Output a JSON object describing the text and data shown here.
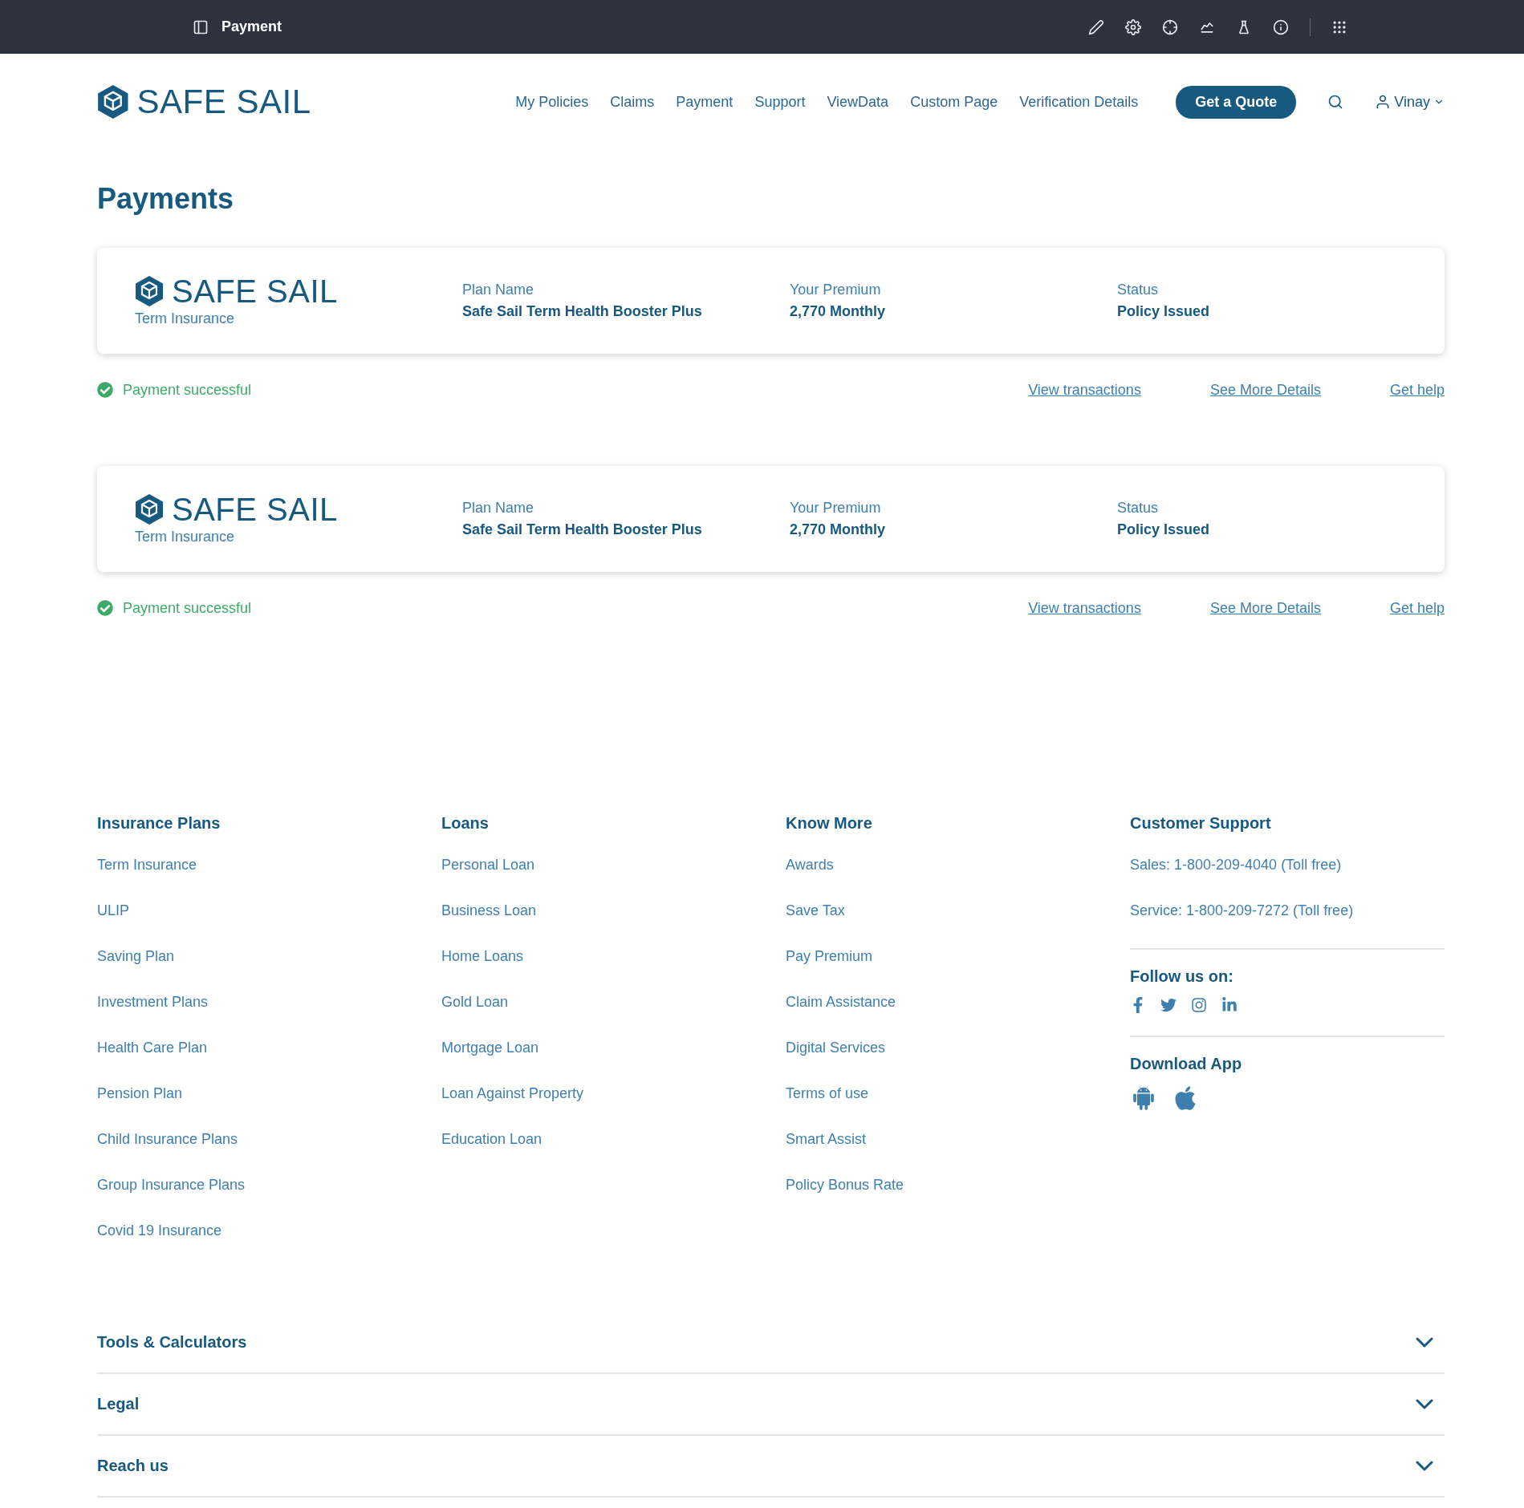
{
  "topbar": {
    "title": "Payment"
  },
  "header": {
    "logo": "SAFE SAIL",
    "nav": [
      "My Policies",
      "Claims",
      "Payment",
      "Support",
      "ViewData",
      "Custom Page",
      "Verification Details"
    ],
    "cta": "Get a Quote",
    "user": "Vinay"
  },
  "page_title": "Payments",
  "payments": [
    {
      "logo": "SAFE SAIL",
      "product": "Term Insurance",
      "plan_label": "Plan Name",
      "plan": "Safe Sail Term Health Booster Plus",
      "premium_label": "Your Premium",
      "premium": "2,770 Monthly",
      "status_label": "Status",
      "status": "Policy Issued",
      "result": "Payment successful",
      "success": true,
      "links": [
        "View transactions",
        "See More Details",
        "Get help"
      ]
    },
    {
      "logo": "SAFE SAIL",
      "product": "Term Insurance",
      "plan_label": "Plan Name",
      "plan": "Safe Sail Term Health Booster Plus",
      "premium_label": "Your Premium",
      "premium": "2,770 Monthly",
      "status_label": "Status",
      "status": "Policy Issued",
      "result": "Payment successful",
      "success": true,
      "links": [
        "View transactions",
        "See More Details",
        "Get help"
      ]
    }
  ],
  "footer": {
    "columns": [
      {
        "title": "Insurance Plans",
        "links": [
          "Term Insurance",
          "ULIP",
          "Saving Plan",
          "Investment Plans",
          "Health Care Plan",
          "Pension Plan",
          "Child Insurance Plans",
          "Group Insurance Plans",
          "Covid 19 Insurance"
        ]
      },
      {
        "title": "Loans",
        "links": [
          "Personal Loan",
          "Business Loan",
          "Home Loans",
          "Gold Loan",
          "Mortgage Loan",
          "Loan Against Property",
          "Education Loan"
        ]
      },
      {
        "title": "Know More",
        "links": [
          "Awards",
          "Save Tax",
          "Pay Premium",
          "Claim Assistance",
          "Digital Services",
          "Terms of use",
          "Smart Assist",
          "Policy Bonus Rate"
        ]
      }
    ],
    "support": {
      "title": "Customer Support",
      "lines": [
        "Sales: 1-800-209-4040 (Toll free)",
        "Service: 1-800-209-7272 (Toll free)"
      ],
      "follow_title": "Follow us on:",
      "app_title": "Download App"
    },
    "accordions": [
      {
        "title": "Tools & Calculators",
        "expanded": false
      },
      {
        "title": "Legal",
        "expanded": false
      },
      {
        "title": "Reach us",
        "expanded": false
      }
    ]
  }
}
